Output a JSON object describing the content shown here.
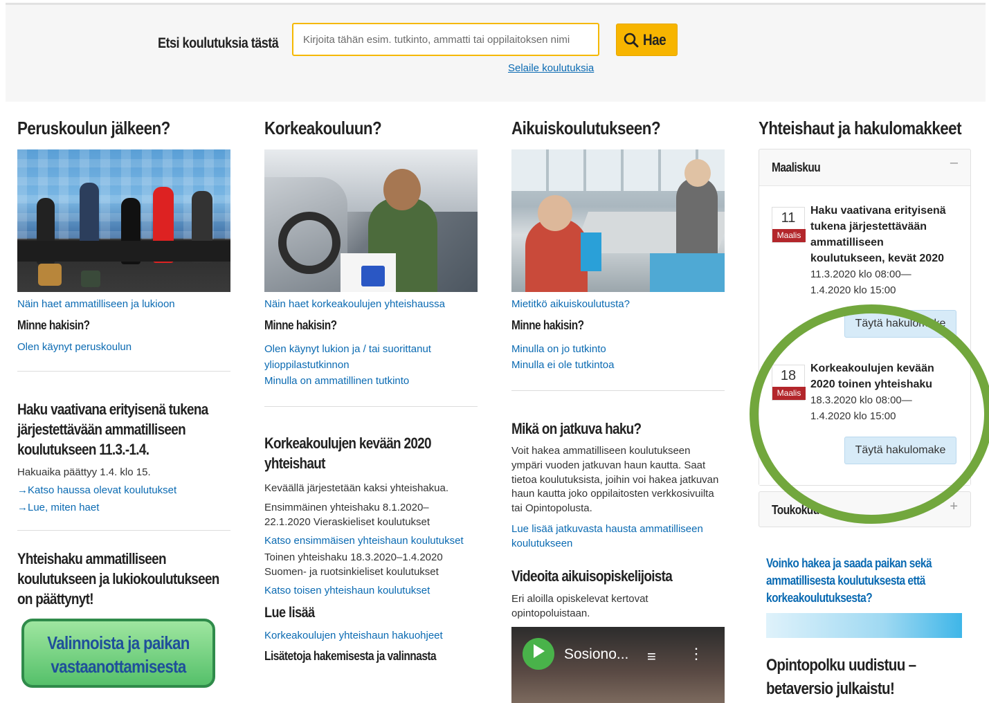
{
  "search": {
    "label": "Etsi koulutuksia tästä",
    "placeholder": "Kirjoita tähän esim. tutkinto, ammatti tai oppilaitoksen nimi",
    "button_label": "Hae",
    "browse_link": "Selaile koulutuksia"
  },
  "col1": {
    "heading": "Peruskoulun jälkeen?",
    "photo_link": "Näin haet ammatilliseen ja lukioon",
    "sub_heading": "Minne hakisin?",
    "link1": "Olen käynyt peruskoulun",
    "news_title": "Haku vaativana erityisenä tukena järjestettävään ammatilliseen koulutukseen 11.3.-1.4.",
    "news_text": "Hakuaika päättyy 1.4. klo 15.",
    "news_link1": "→Katso haussa olevat koulutukset",
    "news_link2": "→Lue, miten haet",
    "news2_title": "Yhteishaku ammatilliseen koulutukseen ja lukiokoulutukseen on päättynyt!",
    "banner_text": "Valinnoista ja paikan vastaanottamisesta"
  },
  "col2": {
    "heading": "Korkeakouluun?",
    "photo_link": "Näin haet korkeakoulujen yhteishaussa",
    "sub_heading": "Minne hakisin?",
    "link1": "Olen käynyt lukion ja / tai suorittanut ylioppilastutkinnon",
    "link2": "Minulla on ammatillinen tutkinto",
    "news_title": "Korkeakoulujen kevään 2020 yhteishaut",
    "p1": "Keväällä järjestetään kaksi yhteishakua.",
    "p2": "Ensimmäinen yhteishaku 8.1.2020–22.1.2020 Vieraskieliset koulutukset",
    "link3": "Katso ensimmäisen yhteishaun koulutukset",
    "p3": "Toinen yhteishaku 18.3.2020–1.4.2020 Suomen- ja ruotsinkieliset koulutukset",
    "link4": "Katso toisen yhteishaun koulutukset",
    "read_more": "Lue lisää",
    "link5": "Korkeakoulujen yhteishaun hakuohjeet",
    "bold_link": "Lisätetoja hakemisesta ja valinnasta"
  },
  "col3": {
    "heading": "Aikuiskoulutukseen?",
    "photo_link": "Mietitkö aikuiskoulutusta?",
    "sub_heading": "Minne hakisin?",
    "link1": "Minulla on jo tutkinto",
    "link2": "Minulla ei ole tutkintoa",
    "news_title": "Mikä on jatkuva haku?",
    "p1": "Voit hakea ammatilliseen koulutukseen ympäri vuoden jatkuvan haun kautta. Saat tietoa koulutuksista, joihin voi hakea jatkuvan haun kautta joko oppilaitosten verkkosivuilta tai Opintopolusta.",
    "link3": "Lue lisää jatkuvasta hausta ammatilliseen koulutukseen",
    "video_title": "Videoita aikuisopiskelijoista",
    "p2": "Eri aloilla opiskelevat kertovat opintopoluistaan.",
    "video_label": "Sosiono..."
  },
  "col4": {
    "heading": "Yhteishaut ja hakulomakkeet",
    "month1": "Maaliskuu",
    "event1": {
      "day": "11",
      "month": "Maalis",
      "title": "Haku vaativana erityisenä tukena järjestettävään ammatilliseen koulutukseen, kevät 2020",
      "time1": "11.3.2020 klo 08:00—",
      "time2": "1.4.2020 klo 15:00",
      "button": "Täytä hakulomake"
    },
    "event2": {
      "day": "18",
      "month": "Maalis",
      "title": "Korkeakoulujen kevään 2020 toinen yhteishaku",
      "time1": "18.3.2020 klo 08:00—",
      "time2": "1.4.2020 klo 15:00",
      "button": "Täytä hakulomake"
    },
    "month2": "Toukokuu",
    "news_link": "Voinko hakea ja saada paikan sekä ammatillisesta koulutuksesta että korkeakoulutuksesta?",
    "news_title": "Opintopolku uudistuu – betaversio julkaistu!"
  },
  "colors": {
    "accent": "#f7b500",
    "link": "#0a6ab2",
    "date_badge": "#b3262b",
    "highlight_circle": "#72a73d"
  }
}
